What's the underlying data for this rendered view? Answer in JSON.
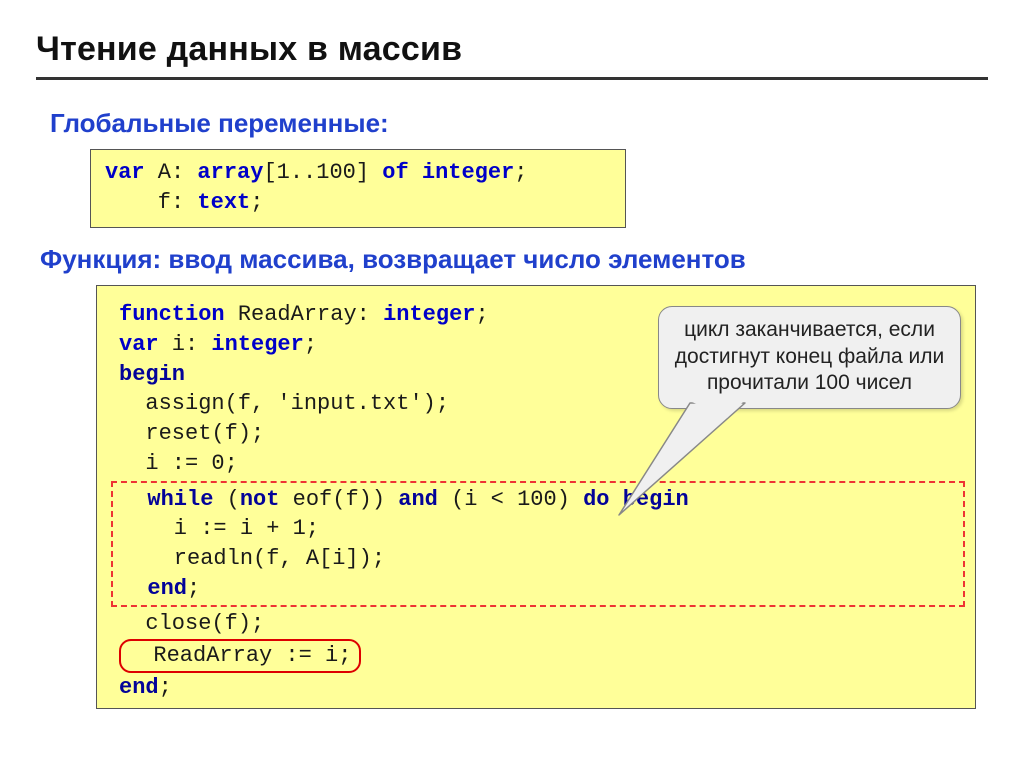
{
  "title": "Чтение данных в массив",
  "subhead1": "Глобальные переменные:",
  "subhead2": "Функция: ввод массива, возвращает число элементов",
  "callout": "цикл заканчивается, если достигнут конец файла или прочитали 100 чисел",
  "code1": {
    "l1_a": "var",
    "l1_b": " A: ",
    "l1_c": "array",
    "l1_d": "[1..100] ",
    "l1_e": "of integer",
    "l1_f": ";",
    "l2_a": "    f: ",
    "l2_b": "text",
    "l2_c": ";"
  },
  "code2": {
    "l1_a": "function",
    "l1_b": " ReadArray: ",
    "l1_c": "integer",
    "l1_d": ";",
    "l2_a": "var",
    "l2_b": " i: ",
    "l2_c": "integer",
    "l2_d": ";",
    "l3": "begin",
    "l4": "  assign(f, 'input.txt');",
    "l5": "  reset(f);",
    "l6": "  i := 0;",
    "l7_a": "  ",
    "l7_b": "while",
    "l7_c": " (",
    "l7_d": "not",
    "l7_e": " eof(f)) ",
    "l7_f": "and",
    "l7_g": " (i < 100) ",
    "l7_h": "do begin",
    "l8": "    i := i + 1;",
    "l9": "    readln(f, A[i]);",
    "l10_a": "  ",
    "l10_b": "end",
    "l10_c": ";",
    "l11": "  close(f);",
    "l12": "  ReadArray := i;",
    "l13_a": "end",
    "l13_b": ";"
  }
}
